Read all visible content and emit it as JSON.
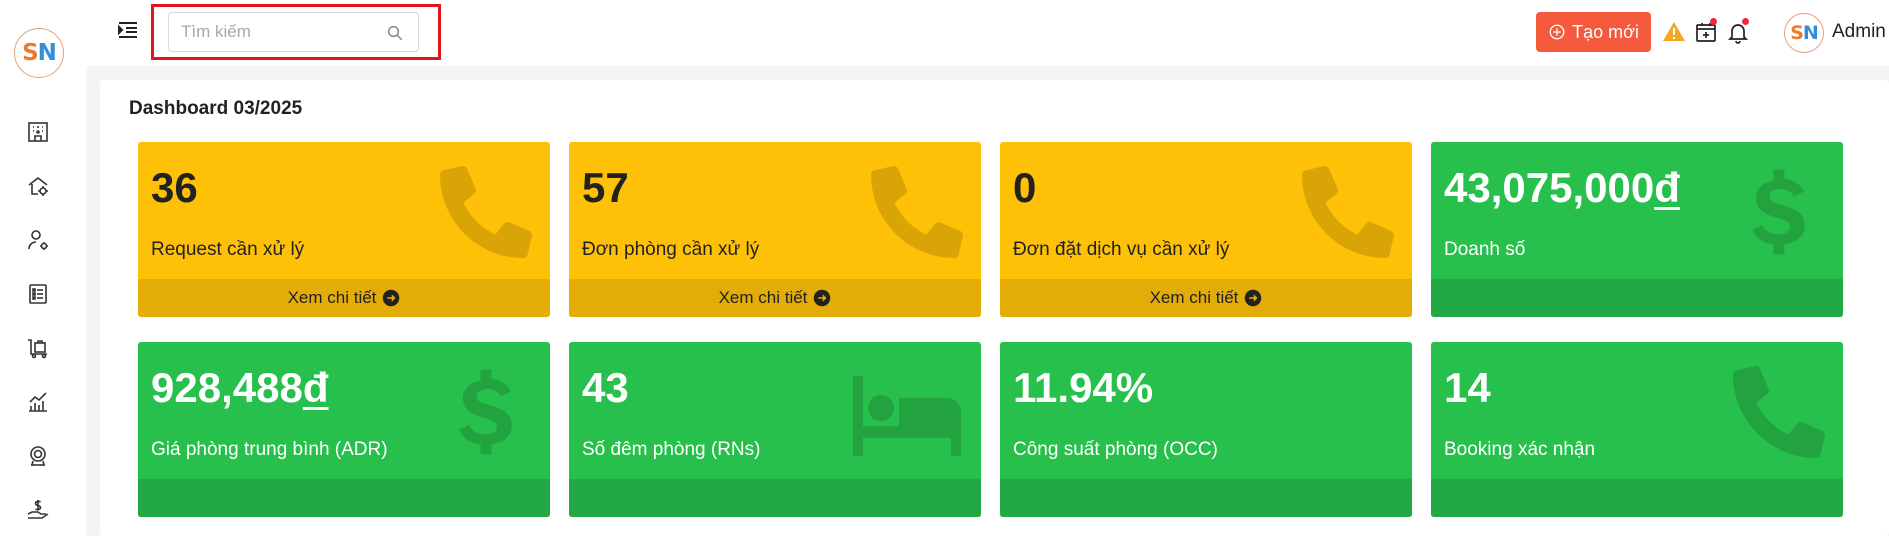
{
  "app": {
    "logo_s": "S",
    "logo_n": "N"
  },
  "sidebar": {
    "items": [
      {
        "icon": "hotel-building-icon"
      },
      {
        "icon": "home-settings-icon"
      },
      {
        "icon": "user-settings-icon"
      },
      {
        "icon": "checklist-icon"
      },
      {
        "icon": "luggage-cart-icon"
      },
      {
        "icon": "chart-report-icon"
      },
      {
        "icon": "support-agent-icon"
      },
      {
        "icon": "money-hand-icon"
      }
    ]
  },
  "header": {
    "search": {
      "placeholder": "Tìm kiếm",
      "value": ""
    },
    "create_label": "Tạo mới",
    "user": {
      "avatar_s": "S",
      "avatar_n": "N",
      "name": "Admin"
    },
    "colors": {
      "create_button": "#f55a3f",
      "warning": "#f5a623",
      "notification_dot": "#f0293d",
      "highlight_border": "#e0161c"
    }
  },
  "dashboard": {
    "title": "Dashboard 03/2025",
    "footer_label": "Xem chi tiết",
    "colors": {
      "yellow": "#ffc107",
      "green": "#28c04c"
    },
    "cards": [
      {
        "value": "36",
        "label": "Request cần xử lý",
        "color": "yellow",
        "icon": "phone-icon",
        "has_link": true
      },
      {
        "value": "57",
        "label": "Đơn phòng cần xử lý",
        "color": "yellow",
        "icon": "phone-icon",
        "has_link": true
      },
      {
        "value": "0",
        "label": "Đơn đặt dịch vụ cần xử lý",
        "color": "yellow",
        "icon": "phone-icon",
        "has_link": true
      },
      {
        "value_number": "43,075,000",
        "currency": "đ",
        "label": "Doanh số",
        "color": "green",
        "icon": "dollar-icon",
        "has_link": false
      },
      {
        "value_number": "928,488",
        "currency": "đ",
        "label": "Giá phòng trung bình (ADR)",
        "color": "green",
        "icon": "dollar-icon",
        "has_link": false
      },
      {
        "value": "43",
        "label": "Số đêm phòng (RNs)",
        "color": "green",
        "icon": "bed-icon",
        "has_link": false
      },
      {
        "value": "11.94%",
        "label": "Công suất phòng (OCC)",
        "color": "green",
        "icon": "",
        "has_link": false
      },
      {
        "value": "14",
        "label": "Booking xác nhận",
        "color": "green",
        "icon": "phone-icon",
        "has_link": false
      }
    ]
  }
}
